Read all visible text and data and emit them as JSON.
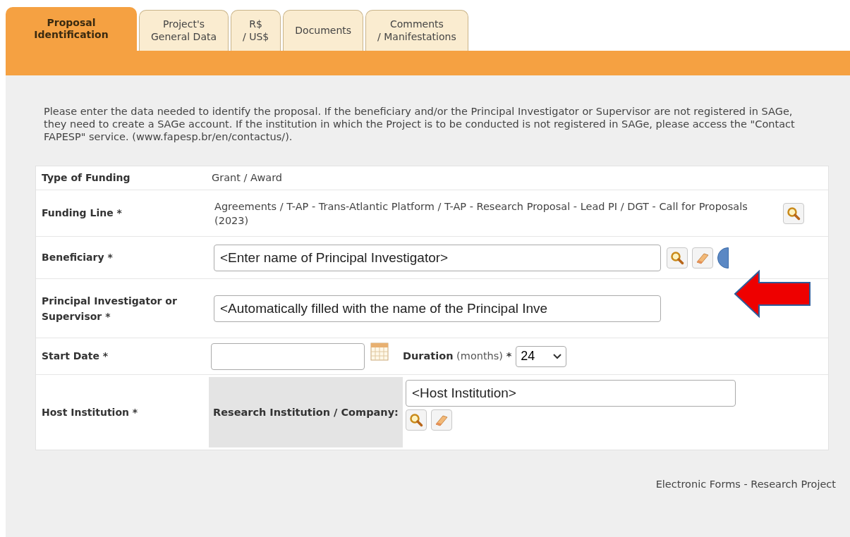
{
  "tabs": [
    {
      "label": "Proposal Identification",
      "selected": true
    },
    {
      "label": "Project's General Data",
      "selected": false
    },
    {
      "label": "R$ / US$",
      "selected": false
    },
    {
      "label": "Documents",
      "selected": false
    },
    {
      "label": "Comments / Manifestations",
      "selected": false
    }
  ],
  "intro": "Please enter the data needed to identify the proposal. If the beneficiary and/or the Principal Investigator or Supervisor are not registered in SAGe, they need to create a SAGe account. If the institution in which the Project is to be conducted is not registered in SAGe, please access the \"Contact FAPESP\" service. (www.fapesp.br/en/contactus/).",
  "form": {
    "type_of_funding": {
      "label": "Type of Funding",
      "value": "Grant / Award"
    },
    "funding_line": {
      "label": "Funding Line *",
      "value": "Agreements / T-AP - Trans-Atlantic Platform / T-AP - Research Proposal - Lead PI / DGT - Call for Proposals (2023)"
    },
    "beneficiary": {
      "label": "Beneficiary *",
      "value": "<Enter name of Principal Investigator>"
    },
    "principal_investigator": {
      "label": "Principal Investigator or Supervisor *",
      "value": "<Automatically filled with the name of the Principal Inve"
    },
    "start_date": {
      "label": "Start Date *"
    },
    "duration": {
      "label": "Duration",
      "unit": "(months)",
      "required_mark": "*",
      "value": "24"
    },
    "host_institution": {
      "label": "Host Institution *",
      "sub_label": "Research Institution / Company:",
      "value": "<Host Institution>"
    }
  },
  "footer": "Electronic Forms - Research Project"
}
